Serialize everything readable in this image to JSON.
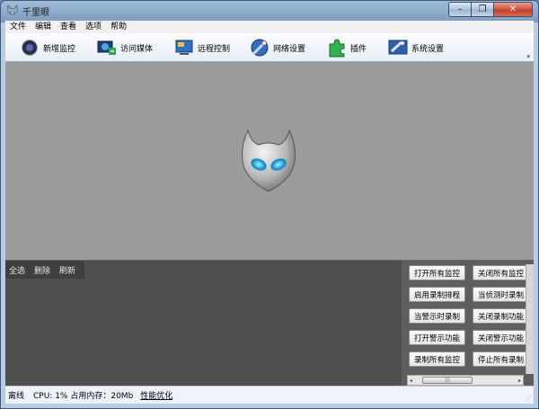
{
  "window": {
    "title": "千里眼"
  },
  "menu": [
    "文件",
    "编辑",
    "查看",
    "选项",
    "帮助"
  ],
  "toolbar": [
    {
      "label": "新增监控",
      "icon": "add-monitor-icon"
    },
    {
      "label": "访问媒体",
      "icon": "media-icon"
    },
    {
      "label": "远程控制",
      "icon": "remote-control-icon"
    },
    {
      "label": "网络设置",
      "icon": "network-settings-icon"
    },
    {
      "label": "插件",
      "icon": "plugin-icon"
    },
    {
      "label": "系统设置",
      "icon": "system-settings-icon"
    }
  ],
  "log_tools": [
    "全选",
    "删除",
    "刷新"
  ],
  "commands": [
    [
      "打开所有监控",
      "关闭所有监控"
    ],
    [
      "启用录制排程",
      "当侦测时录制"
    ],
    [
      "当警示时录制",
      "关闭录制功能"
    ],
    [
      "打开警示功能",
      "关闭警示功能"
    ],
    [
      "录制所有监控",
      "停止所有录制"
    ]
  ],
  "status": {
    "state": "离线",
    "cpu": "CPU: 1% 占用内存：20Mb",
    "link": "性能优化"
  },
  "colors": {
    "preview_bg": "#9b9b9b",
    "log_bg": "#4f4f4f",
    "accent": "#2aa8e8"
  }
}
